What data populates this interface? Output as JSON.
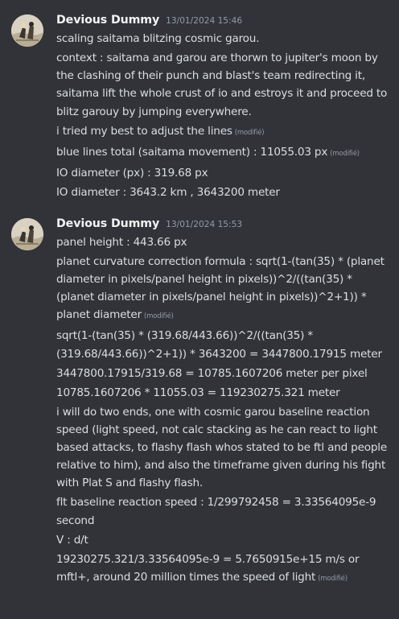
{
  "messages": [
    {
      "author": "Devious Dummy",
      "timestamp": "13/01/2024 15:46",
      "lines": [
        {
          "text": "scaling saitama blitzing cosmic garou.",
          "edited": ""
        },
        {
          "text": "context : saitama and garou are thorwn to jupiter's moon by the clashing of their punch and blast's team redirecting it, saitama lift the whole crust of io and estroys it and proceed to blitz garouy by jumping everywhere.",
          "edited": ""
        },
        {
          "text": "i tried my best to adjust the lines",
          "edited": "(modifié)"
        },
        {
          "text": "blue lines total (saitama movement) : 11055.03 px",
          "edited": "(modifié)"
        },
        {
          "text": "IO diameter (px)  : 319.68 px",
          "edited": ""
        },
        {
          "text": "IO diameter : 3643.2 km , 3643200 meter",
          "edited": ""
        }
      ]
    },
    {
      "author": "Devious Dummy",
      "timestamp": "13/01/2024 15:53",
      "lines": [
        {
          "text": "panel height : 443.66 px",
          "edited": ""
        },
        {
          "text": "planet curvature correction formula : sqrt(1-(tan(35) * (planet diameter in pixels/panel height in pixels))^2/((tan(35) * (planet diameter in pixels/panel height in pixels))^2+1)) * planet diameter",
          "edited": "(modifié)"
        },
        {
          "text": "sqrt(1-(tan(35) * (319.68/443.66))^2/((tan(35) * (319.68/443.66))^2+1)) * 3643200 = 3447800.17915 meter",
          "edited": ""
        },
        {
          "text": "3447800.17915/319.68 = 10785.1607206 meter per pixel",
          "edited": ""
        },
        {
          "text": "10785.1607206 * 11055.03 = 119230275.321 meter",
          "edited": ""
        },
        {
          "text": "i will do two ends, one with cosmic garou baseline reaction speed (light speed, not calc stacking as he can react to light based attacks, to flashy flash whos stated to be ftl and people relative to him), and also the timeframe given during his fight with Plat S and flashy flash.",
          "edited": ""
        },
        {
          "text": "flt baseline reaction speed : 1/299792458 = 3.33564095e-9 second",
          "edited": ""
        },
        {
          "text": "V : d/t",
          "edited": ""
        },
        {
          "text": "19230275.321/3.33564095e-9 = 5.7650915e+15 m/s or mftl+, around 20 million times the speed of light",
          "edited": "(modifié)"
        }
      ]
    }
  ]
}
